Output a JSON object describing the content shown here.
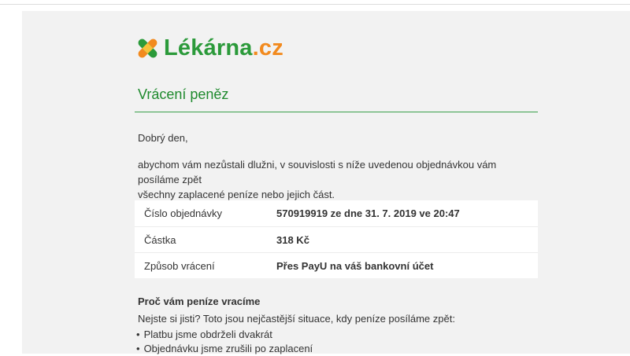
{
  "brand": {
    "name": "Lékárna",
    "tld": ".cz",
    "colors": {
      "green": "#2b9a3a",
      "orange": "#f28a1e"
    }
  },
  "email": {
    "heading": "Vrácení peněz",
    "greeting": "Dobrý den,",
    "body_line1": "abychom vám nezůstali dlužni, v souvislosti s níže uvedenou objednávkou vám posíláme zpět",
    "body_line2": "všechny zaplacené peníze nebo jejich část.",
    "details": [
      {
        "label": "Číslo objednávky",
        "value": "570919919 ze dne 31. 7. 2019 ve 20:47"
      },
      {
        "label": "Částka",
        "value": "318 Kč"
      },
      {
        "label": "Způsob vrácení",
        "value": "Přes PayU na váš bankovní účet"
      }
    ],
    "why": {
      "title": "Proč vám peníze vracíme",
      "intro": "Nejste si jisti? Toto jsou nejčastější situace, kdy peníze posíláme zpět:",
      "reasons": [
        "Platbu jsme obdrželi dvakrát",
        "Objednávku jsme zrušili po zaplacení"
      ]
    }
  }
}
